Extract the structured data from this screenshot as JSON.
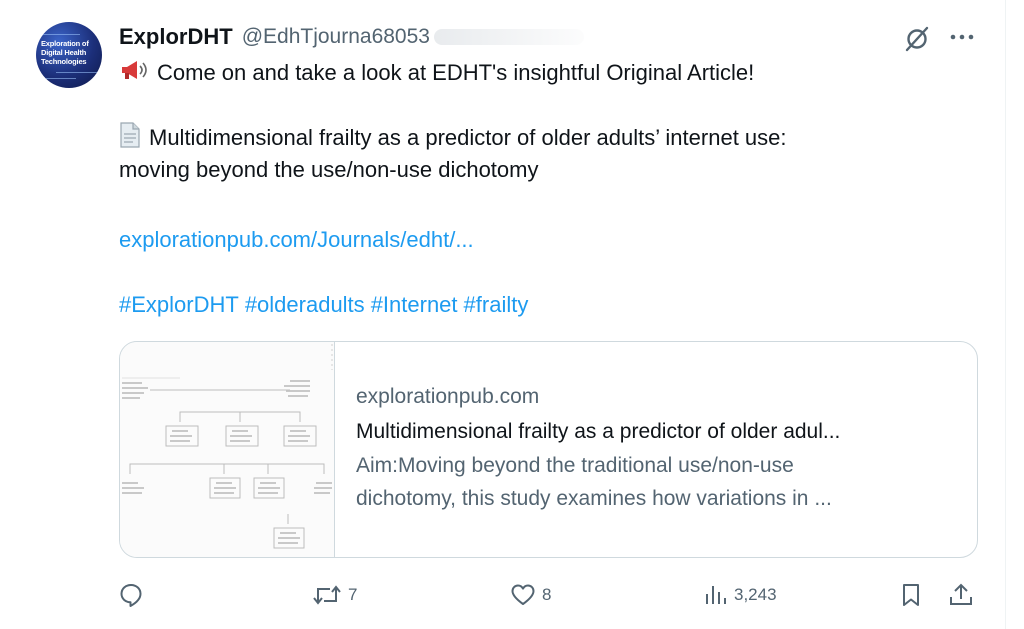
{
  "tweet": {
    "display_name": "ExplorDHT",
    "handle": "@EdhTjourna68053",
    "avatar_text": "Exploration of Digital Health Technologies",
    "line1": "Come on and take a look at EDHT's insightful Original Article!",
    "line2": "Multidimensional frailty as a predictor of older adults’ internet use:",
    "line3": "moving beyond the use/non-use dichotomy",
    "link": "explorationpub.com/Journals/edht/...",
    "hashtags": [
      "#ExplorDHT",
      "#olderadults",
      "#Internet",
      "#frailty"
    ]
  },
  "card": {
    "domain": "explorationpub.com",
    "title": "Multidimensional frailty as a predictor of older adul...",
    "desc_line1": "Aim:Moving beyond the traditional use/non-use",
    "desc_line2": "dichotomy, this study examines how variations in ..."
  },
  "actions": {
    "replies": "",
    "reposts": "7",
    "likes": "8",
    "views": "3,243"
  },
  "icons": {
    "megaphone": "megaphone-icon",
    "document": "document-icon",
    "grok": "grok-icon",
    "more": "more-icon",
    "reply": "reply-icon",
    "repost": "repost-icon",
    "like": "heart-icon",
    "views": "views-icon",
    "bookmark": "bookmark-icon",
    "share": "share-icon"
  },
  "colors": {
    "link": "#1d9bf0",
    "secondary": "#536471",
    "text": "#0f1419",
    "border": "#cfd9de"
  }
}
